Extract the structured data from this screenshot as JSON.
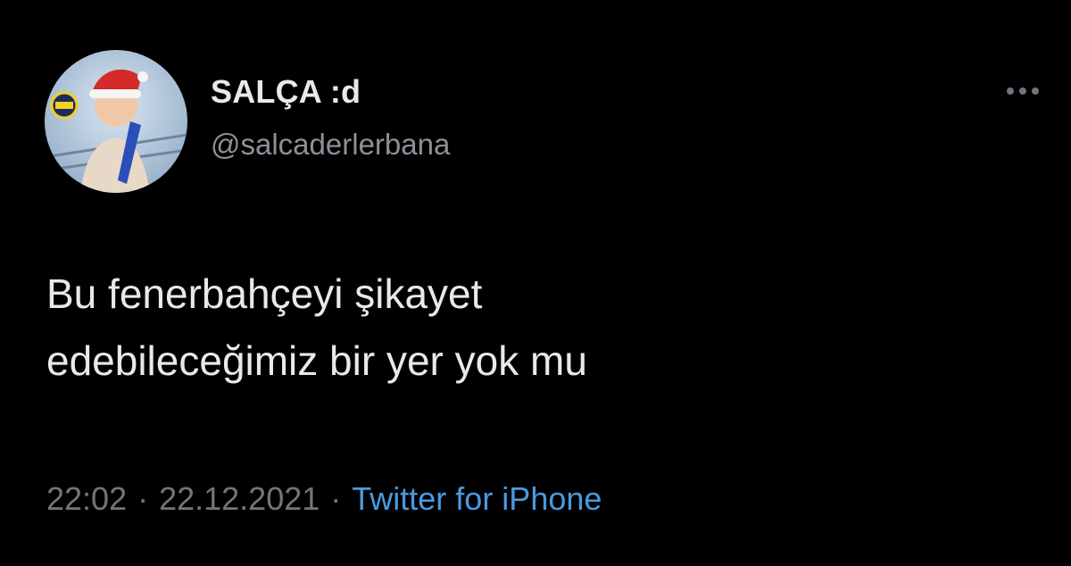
{
  "tweet": {
    "display_name": "SALÇA :d",
    "handle": "@salcaderlerbana",
    "text_lines": [
      "Bu fenerbahçeyi şikayet",
      "edebileceğimiz bir yer yok mu"
    ],
    "time": "22:02",
    "separator": "·",
    "date": "22.12.2021",
    "source": "Twitter for iPhone"
  },
  "icons": {
    "more": "more-options-icon",
    "avatar": "profile-avatar"
  },
  "colors": {
    "background": "#000000",
    "text": "#e7e9ea",
    "secondary": "#71767b",
    "link": "#4a9ae0"
  }
}
